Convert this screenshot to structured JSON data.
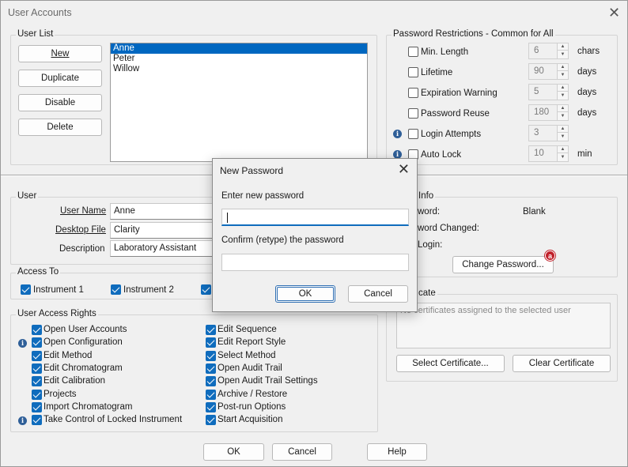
{
  "window": {
    "title": "User Accounts"
  },
  "user_list": {
    "legend": "User List",
    "buttons": {
      "new": "New",
      "duplicate": "Duplicate",
      "disable": "Disable",
      "delete": "Delete"
    },
    "users": [
      "Anne",
      "Peter",
      "Willow"
    ],
    "selected_index": 0
  },
  "restrictions": {
    "legend": "Password Restrictions - Common for All",
    "rows": [
      {
        "label": "Min. Length",
        "value": "6",
        "unit": "chars",
        "checked": false,
        "info": false
      },
      {
        "label": "Lifetime",
        "value": "90",
        "unit": "days",
        "checked": false,
        "info": false
      },
      {
        "label": "Expiration Warning",
        "value": "5",
        "unit": "days",
        "checked": false,
        "info": false
      },
      {
        "label": "Password Reuse",
        "value": "180",
        "unit": "days",
        "checked": false,
        "info": false
      },
      {
        "label": "Login Attempts",
        "value": "3",
        "unit": "",
        "checked": false,
        "info": true
      },
      {
        "label": "Auto Lock",
        "value": "10",
        "unit": "min",
        "checked": false,
        "info": true
      }
    ]
  },
  "user": {
    "legend": "User",
    "user_name_label": "User Name",
    "user_name": "Anne",
    "desktop_file_label": "Desktop File",
    "desktop_file": "Clarity",
    "description_label": "Description",
    "description": "Laboratory Assistant"
  },
  "password_info": {
    "legend_partial": "Info",
    "password_label_partial": "word:",
    "password_value": "Blank",
    "changed_label_partial": "word Changed:",
    "login_label_partial": "Login:",
    "change_button": "Change Password...",
    "badge": "a"
  },
  "access_to": {
    "legend": "Access To",
    "items": [
      {
        "label": "Instrument 1",
        "checked": true
      },
      {
        "label": "Instrument 2",
        "checked": true
      },
      {
        "label": "",
        "checked": true
      }
    ]
  },
  "certificate": {
    "legend_partial": "cate",
    "empty_text": "No certificates assigned to the selected user",
    "select_button": "Select Certificate...",
    "clear_button": "Clear Certificate"
  },
  "access_rights": {
    "legend": "User Access Rights",
    "left": [
      {
        "label": "Open User Accounts",
        "info": false
      },
      {
        "label": "Open Configuration",
        "info": true
      },
      {
        "label": "Edit Method",
        "info": false
      },
      {
        "label": "Edit Chromatogram",
        "info": false
      },
      {
        "label": "Edit Calibration",
        "info": false
      },
      {
        "label": "Projects",
        "info": false
      },
      {
        "label": "Import Chromatogram",
        "info": false
      },
      {
        "label": "Take Control of Locked Instrument",
        "info": true
      }
    ],
    "right": [
      {
        "label": "Edit Sequence"
      },
      {
        "label": "Edit Report Style"
      },
      {
        "label": "Select Method"
      },
      {
        "label": "Open Audit Trail"
      },
      {
        "label": "Open Audit Trail Settings"
      },
      {
        "label": "Archive / Restore"
      },
      {
        "label": "Post-run Options"
      },
      {
        "label": "Start Acquisition"
      }
    ]
  },
  "footer": {
    "ok": "OK",
    "cancel": "Cancel",
    "help": "Help"
  },
  "dialog": {
    "title": "New Password",
    "enter_label": "Enter new password",
    "confirm_label": "Confirm (retype) the password",
    "ok": "OK",
    "cancel": "Cancel"
  },
  "colors": {
    "accent": "#0f6cbd",
    "selection": "#0067c0",
    "badge": "#c0202a",
    "info": "#2f5f98"
  }
}
